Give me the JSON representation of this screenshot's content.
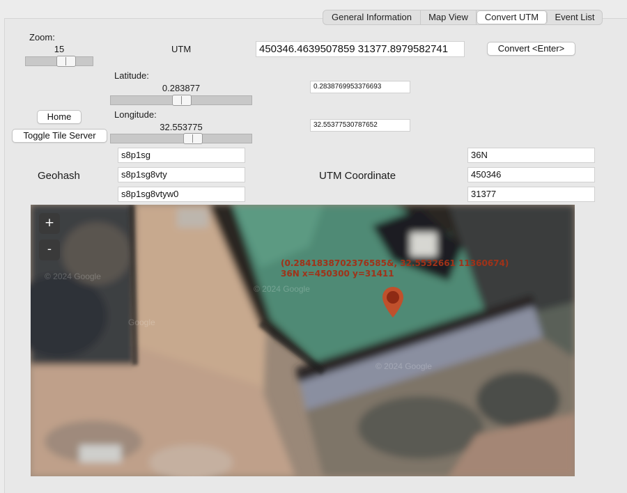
{
  "tabs": [
    {
      "label": "General Information",
      "active": false
    },
    {
      "label": "Map View",
      "active": false
    },
    {
      "label": "Convert UTM",
      "active": true
    },
    {
      "label": "Event List",
      "active": false
    }
  ],
  "zoom": {
    "label": "Zoom:",
    "value": "15",
    "level_fraction": 0.6
  },
  "utm": {
    "label": "UTM",
    "input_value": "450346.4639507859 31377.8979582741",
    "convert_button": "Convert <Enter>"
  },
  "latitude": {
    "label": "Latitude:",
    "value": "0.283877",
    "field_value": "0.2838769953376693",
    "level_fraction": 0.6
  },
  "longitude": {
    "label": "Longitude:",
    "value": "32.553775",
    "field_value": "32.55377530787652",
    "level_fraction": 0.68
  },
  "buttons": {
    "home": "Home",
    "toggle_tile_server": "Toggle Tile Server"
  },
  "geohash": {
    "label": "Geohash",
    "values": [
      "s8p1sg",
      "s8p1sg8vty",
      "s8p1sg8vtyw0"
    ]
  },
  "utm_coordinate": {
    "label": "UTM Coordinate",
    "values": [
      "36N",
      "450346",
      "31377"
    ]
  },
  "map": {
    "zoom_in": "+",
    "zoom_out": "-",
    "marker_line1": "(0.2841838702376585&, 32.5532661 11360674)",
    "marker_line2": "36N x=450300 y=31411",
    "watermark": "© 2024 Google",
    "watermark_short": "Google",
    "marker_color": "#c0502c"
  }
}
